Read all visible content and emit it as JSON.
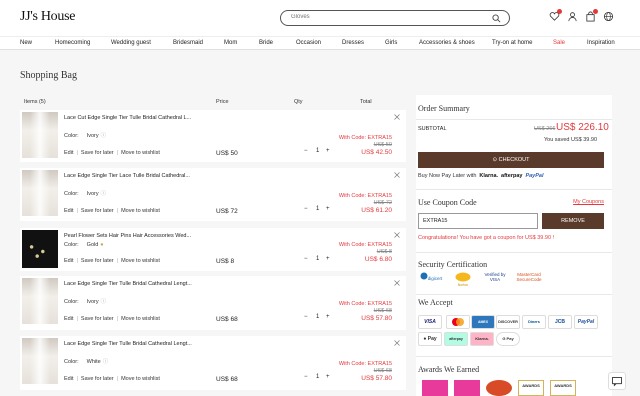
{
  "header": {
    "logo": "JJ's House",
    "search_placeholder": "Gloves"
  },
  "nav": [
    "New",
    "Homecoming",
    "Wedding guest",
    "Bridesmaid",
    "Mom",
    "Bride",
    "Occasion",
    "Dresses",
    "Girls",
    "Accessories & shoes",
    "Try-on at home",
    "Sale",
    "Inspiration"
  ],
  "page_title": "Shopping Bag",
  "cart_headers": {
    "items": "Items (5)",
    "price": "Price",
    "qty": "Qty",
    "total": "Total"
  },
  "items": [
    {
      "name": "Lace Cut Edge Single Tier Tulle Bridal Cathedral L...",
      "color_label": "Color:",
      "color": "Ivory",
      "price": "US$ 50",
      "qty": "1",
      "promo": "With Code: EXTRA15",
      "old_total": "US$ 50",
      "new_total": "US$ 42.50"
    },
    {
      "name": "Lace Edge Single Tier Lace Tulle Bridal Cathedral...",
      "color_label": "Color:",
      "color": "Ivory",
      "price": "US$ 72",
      "qty": "1",
      "promo": "With Code: EXTRA15",
      "old_total": "US$ 72",
      "new_total": "US$ 61.20"
    },
    {
      "name": "Pearl Flower Sets Hair Pins Hair Accessories Wed...",
      "color_label": "Color:",
      "color": "Gold",
      "price": "US$ 8",
      "qty": "1",
      "promo": "With Code: EXTRA15",
      "old_total": "US$ 8",
      "new_total": "US$ 6.80"
    },
    {
      "name": "Lace Edge Single Tier Tulle Bridal Cathedral Lengt...",
      "color_label": "Color:",
      "color": "Ivory",
      "price": "US$ 68",
      "qty": "1",
      "promo": "With Code: EXTRA15",
      "old_total": "US$ 68",
      "new_total": "US$ 57.80"
    },
    {
      "name": "Lace Edge Single Tier Tulle Bridal Cathedral Lengt...",
      "color_label": "Color:",
      "color": "White",
      "price": "US$ 68",
      "qty": "1",
      "promo": "With Code: EXTRA15",
      "old_total": "US$ 68",
      "new_total": "US$ 57.80"
    }
  ],
  "item_actions": {
    "edit": "Edit",
    "save": "Save for later",
    "wishlist": "Move to wishlist"
  },
  "summary": {
    "title": "Order Summary",
    "subtotal_label": "SUBTOTAL",
    "subtotal_old": "US$ 266",
    "subtotal_new": "US$ 226.10",
    "saved": "You saved US$ 39.90",
    "checkout": "CHECKOUT",
    "bnpl": "Buy Now Pay Later with",
    "bnpl_klarna": "Klarna.",
    "bnpl_afterpay": "afterpay",
    "bnpl_paypal": "PayPal",
    "coupon_title": "Use Coupon Code",
    "my_coupons": "My Coupons",
    "coupon_value": "EXTRA15",
    "remove": "REMOVE",
    "congrats": "Congratulations! You have got a coupon for US$ 39.90 !",
    "security_title": "Security Certification",
    "security_logos": [
      "digicert",
      "Norton",
      "Verified by VISA",
      "MasterCard SecureCode"
    ],
    "accept_title": "We Accept",
    "payments_row1": [
      "VISA",
      "MC",
      "AMEX",
      "DISCOVER",
      "Diners",
      "JCB",
      "PayPal"
    ],
    "payments_row2": [
      "Pay",
      "afterpay",
      "Klarna.",
      "G Pay"
    ],
    "awards_title": "Awards We Earned",
    "awards": [
      "",
      "",
      "",
      "AWARDS",
      "AWARDS"
    ]
  },
  "colors": {
    "accent": "#e4393c",
    "button": "#5a3a2a"
  }
}
